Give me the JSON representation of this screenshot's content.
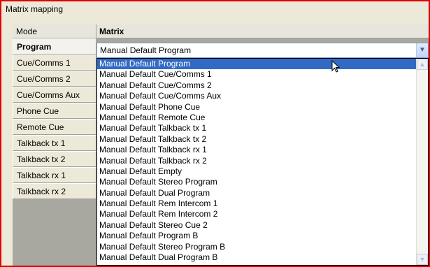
{
  "window": {
    "title": "Matrix mapping"
  },
  "columns": {
    "mode": "Mode",
    "matrix": "Matrix"
  },
  "modes": [
    {
      "label": "Program",
      "selected": true
    },
    {
      "label": "Cue/Comms 1",
      "selected": false
    },
    {
      "label": "Cue/Comms 2",
      "selected": false
    },
    {
      "label": "Cue/Comms Aux",
      "selected": false
    },
    {
      "label": "Phone Cue",
      "selected": false
    },
    {
      "label": "Remote Cue",
      "selected": false
    },
    {
      "label": "Talkback tx 1",
      "selected": false
    },
    {
      "label": "Talkback tx 2",
      "selected": false
    },
    {
      "label": "Talkback rx 1",
      "selected": false
    },
    {
      "label": "Talkback rx 2",
      "selected": false
    }
  ],
  "combo": {
    "value": "Manual Default Program",
    "dropdown_icon": "chevron-down-icon"
  },
  "options": [
    "Manual Default Program",
    "Manual Default Cue/Comms 1",
    "Manual Default Cue/Comms 2",
    "Manual Default Cue/Comms Aux",
    "Manual Default Phone Cue",
    "Manual Default Remote Cue",
    "Manual Default Talkback tx 1",
    "Manual Default Talkback tx 2",
    "Manual Default Talkback rx 1",
    "Manual Default Talkback rx 2",
    "Manual Default Empty",
    "Manual Default Stereo Program",
    "Manual Default Dual Program",
    "Manual Default Rem Intercom 1",
    "Manual Default Rem Intercom 2",
    "Manual Default Stereo Cue 2",
    "Manual Default Program B",
    "Manual Default Stereo Program B",
    "Manual Default Dual Program B"
  ],
  "highlighted_option": 0,
  "colors": {
    "frame_border": "#e00000",
    "selection": "#316ac5"
  }
}
